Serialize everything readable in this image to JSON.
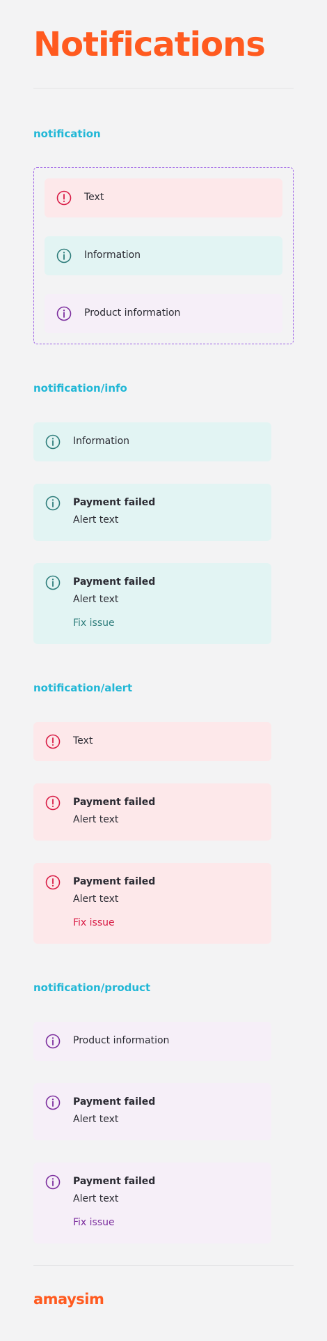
{
  "page": {
    "title": "Notifications"
  },
  "colors": {
    "accent": "#ff5a1f",
    "section_title": "#21b7d6",
    "alert_bg": "#fde8ea",
    "alert_icon": "#d81b45",
    "info_bg": "#e2f4f3",
    "info_icon": "#2e7d7b",
    "product_bg": "#f6eff8",
    "product_icon": "#7c2e9e",
    "frame_border": "#9b5de5"
  },
  "sections": {
    "notification": {
      "title": "notification",
      "items": [
        {
          "variant": "alert",
          "icon": "exclamation-circle-icon",
          "text": "Text"
        },
        {
          "variant": "info",
          "icon": "info-circle-icon",
          "text": "Information"
        },
        {
          "variant": "product",
          "icon": "info-circle-icon",
          "text": "Product information"
        }
      ]
    },
    "info": {
      "title": "notification/info",
      "simple": {
        "icon": "info-circle-icon",
        "text": "Information"
      },
      "with_heading": {
        "icon": "info-circle-icon",
        "heading": "Payment failed",
        "body": "Alert text"
      },
      "with_action": {
        "icon": "info-circle-icon",
        "heading": "Payment failed",
        "body": "Alert text",
        "action": "Fix issue"
      }
    },
    "alert": {
      "title": "notification/alert",
      "simple": {
        "icon": "exclamation-circle-icon",
        "text": "Text"
      },
      "with_heading": {
        "icon": "exclamation-circle-icon",
        "heading": "Payment failed",
        "body": "Alert text"
      },
      "with_action": {
        "icon": "exclamation-circle-icon",
        "heading": "Payment failed",
        "body": "Alert text",
        "action": "Fix issue"
      }
    },
    "product": {
      "title": "notification/product",
      "simple": {
        "icon": "info-circle-icon",
        "text": "Product information"
      },
      "with_heading": {
        "icon": "info-circle-icon",
        "heading": "Payment failed",
        "body": "Alert text"
      },
      "with_action": {
        "icon": "info-circle-icon",
        "heading": "Payment failed",
        "body": "Alert text",
        "action": "Fix issue"
      }
    }
  },
  "footer": {
    "logo": "amaysim"
  }
}
